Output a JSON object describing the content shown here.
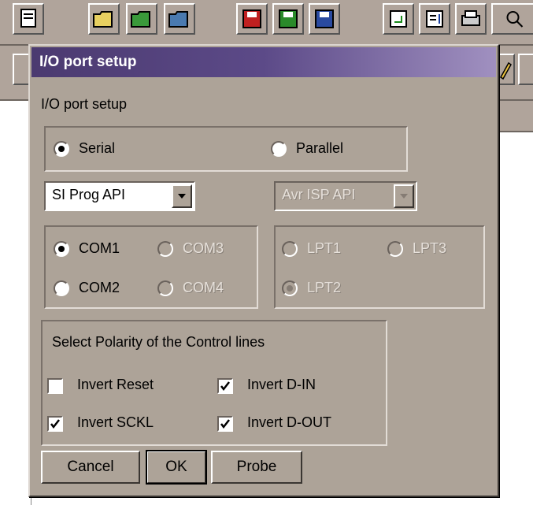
{
  "dialog": {
    "title": "I/O port setup",
    "heading": "I/O port setup"
  },
  "mode": {
    "serial_label": "Serial",
    "parallel_label": "Parallel",
    "selected": "Serial"
  },
  "serial_api": {
    "value": "SI Prog API"
  },
  "parallel_api": {
    "value": "Avr ISP API"
  },
  "com_ports": {
    "com1": "COM1",
    "com2": "COM2",
    "com3": "COM3",
    "com4": "COM4",
    "selected": "COM1"
  },
  "lpt_ports": {
    "lpt1": "LPT1",
    "lpt2": "LPT2",
    "lpt3": "LPT3",
    "selected": "LPT2"
  },
  "polarity": {
    "heading": "Select Polarity of the Control lines",
    "invert_reset": {
      "label": "Invert Reset",
      "checked": false
    },
    "invert_din": {
      "label": "Invert D-IN",
      "checked": true
    },
    "invert_sckl": {
      "label": "Invert SCKL",
      "checked": true
    },
    "invert_dout": {
      "label": "Invert D-OUT",
      "checked": true
    }
  },
  "buttons": {
    "cancel": "Cancel",
    "ok": "OK",
    "probe": "Probe"
  },
  "colors": {
    "dialog_bg": "#ada398",
    "title_start": "#4b3a70",
    "title_end": "#a090c0"
  }
}
